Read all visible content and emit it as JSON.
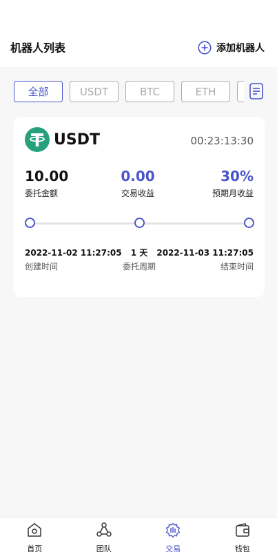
{
  "header": {
    "title": "机器人列表",
    "add_label": "添加机器人"
  },
  "filters": {
    "tabs": [
      {
        "label": "全部",
        "active": true
      },
      {
        "label": "USDT",
        "active": false
      },
      {
        "label": "BTC",
        "active": false
      },
      {
        "label": "ETH",
        "active": false
      },
      {
        "label": "",
        "active": false
      }
    ],
    "list_icon": "list-icon"
  },
  "robot_card": {
    "coin": "USDT",
    "coin_icon": "tether-logo",
    "countdown": "00:23:13:30",
    "amount": {
      "value": "10.00",
      "label": "委托金额"
    },
    "profit": {
      "value": "0.00",
      "label": "交易收益"
    },
    "monthly": {
      "value": "30%",
      "label": "预期月收益"
    },
    "start": {
      "value": "2022-11-02 11:27:05",
      "label": "创建时间"
    },
    "period": {
      "value": "1 天",
      "label": "委托周期"
    },
    "end": {
      "value": "2022-11-03 11:27:05",
      "label": "结束时间"
    }
  },
  "tabbar": {
    "items": [
      {
        "label": "首页",
        "icon": "home-icon"
      },
      {
        "label": "团队",
        "icon": "team-icon"
      },
      {
        "label": "交易",
        "icon": "trade-icon",
        "active": true
      },
      {
        "label": "钱包",
        "icon": "wallet-icon"
      }
    ]
  },
  "colors": {
    "accent": "#4a55c9",
    "tether": "#26a17b"
  }
}
